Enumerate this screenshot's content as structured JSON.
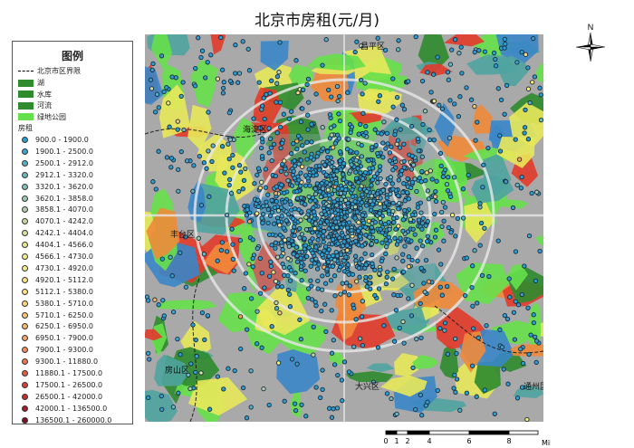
{
  "title": "北京市房租(元/月)",
  "legend": {
    "title": "图例",
    "boundary_label": "北京市区界限",
    "layers": [
      {
        "label": "湖",
        "color": "#2e8b2e"
      },
      {
        "label": "水库",
        "color": "#2e8b2e"
      },
      {
        "label": "河流",
        "color": "#2e8b2e"
      },
      {
        "label": "绿地公园",
        "color": "#66e04a"
      }
    ],
    "rent_heading": "房租",
    "rent_classes": [
      {
        "label": "900.0 - 1900.0",
        "color": "#2b9fd3"
      },
      {
        "label": "1900.1 - 2500.0",
        "color": "#3aa6d0"
      },
      {
        "label": "2500.1 - 2912.0",
        "color": "#55b0c8"
      },
      {
        "label": "2912.1 - 3320.0",
        "color": "#6db8c0"
      },
      {
        "label": "3320.1 - 3620.0",
        "color": "#84c0b8"
      },
      {
        "label": "3620.1 - 3858.0",
        "color": "#9ac8b0"
      },
      {
        "label": "3858.1 - 4070.0",
        "color": "#b0d0a8"
      },
      {
        "label": "4070.1 - 4242.0",
        "color": "#c4d8a0"
      },
      {
        "label": "4242.1 - 4404.0",
        "color": "#d6e098"
      },
      {
        "label": "4404.1 - 4566.0",
        "color": "#e6e890"
      },
      {
        "label": "4566.1 - 4730.0",
        "color": "#f2ee8c"
      },
      {
        "label": "4730.1 - 4920.0",
        "color": "#f8ec88"
      },
      {
        "label": "4920.1 - 5112.0",
        "color": "#fce684"
      },
      {
        "label": "5112.1 - 5380.0",
        "color": "#fde080"
      },
      {
        "label": "5380.1 - 5710.0",
        "color": "#fdd67a"
      },
      {
        "label": "5710.1 - 6250.0",
        "color": "#fcc872"
      },
      {
        "label": "6250.1 - 6950.0",
        "color": "#fab86a"
      },
      {
        "label": "6950.1 - 7900.0",
        "color": "#f7a462"
      },
      {
        "label": "7900.1 - 9300.0",
        "color": "#f38e58"
      },
      {
        "label": "9300.1 - 11880.0",
        "color": "#ee764e"
      },
      {
        "label": "11880.1 - 17500.0",
        "color": "#e55c44"
      },
      {
        "label": "17500.1 - 26500.0",
        "color": "#d8403a"
      },
      {
        "label": "26500.1 - 42000.0",
        "color": "#c42a30"
      },
      {
        "label": "42000.1 - 136500.0",
        "color": "#a81a28"
      },
      {
        "label": "136500.1 - 260000.0",
        "color": "#801020"
      }
    ]
  },
  "map": {
    "district_labels": [
      "昌平区",
      "海淀区",
      "丰台区",
      "房山区",
      "大兴区",
      "通州区"
    ],
    "colors": {
      "base_gray": "#a9a9a9",
      "green": "#66e04a",
      "dark_green": "#2e8b2e",
      "teal": "#4fa3a0",
      "blue": "#3a86c8",
      "yellow": "#e8e85a",
      "orange": "#f08a3a",
      "red": "#e23a2a",
      "dot_fill": "#2b9fd3",
      "dot_stroke": "#1a2a3a"
    }
  },
  "compass": {
    "label": "N"
  },
  "scale": {
    "ticks": [
      "0",
      "1",
      "2",
      "4",
      "6",
      "8"
    ],
    "unit": "Miles"
  }
}
